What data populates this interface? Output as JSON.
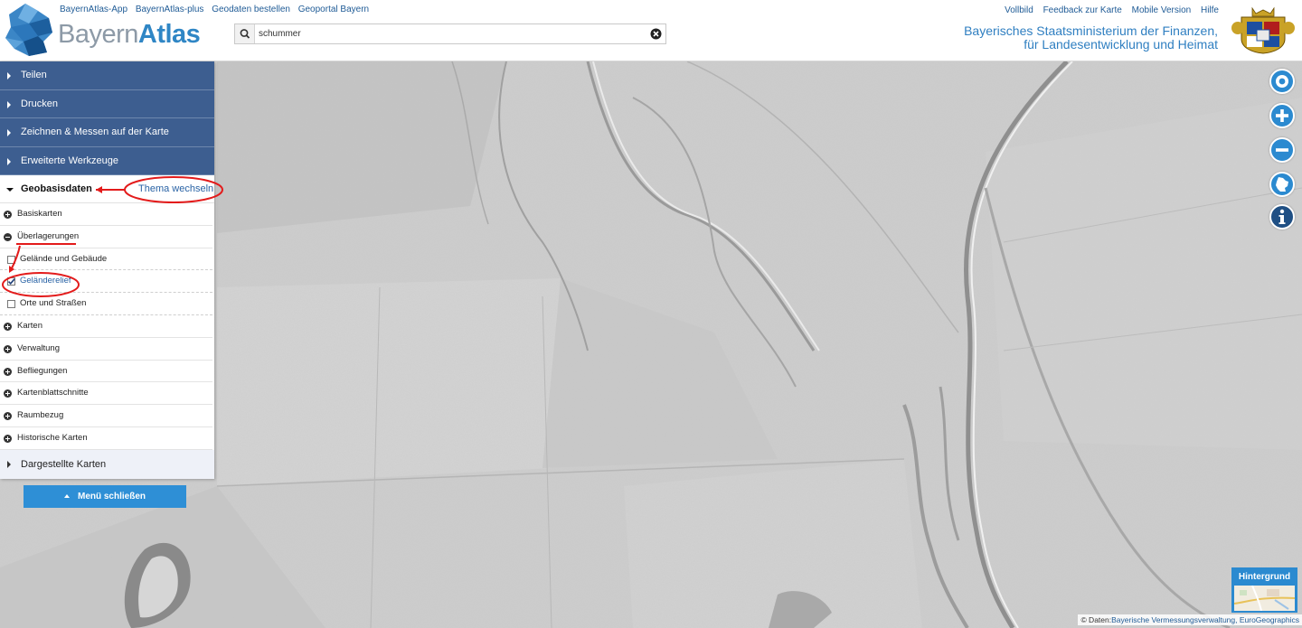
{
  "header": {
    "top_links": [
      "BayernAtlas-App",
      "BayernAtlas-plus",
      "Geodaten bestellen",
      "Geoportal Bayern"
    ],
    "brand_part1": "Bayern",
    "brand_part2": "Atlas",
    "right_links": [
      "Vollbild",
      "Feedback zur Karte",
      "Mobile Version",
      "Hilfe"
    ],
    "ministry_line1": "Bayerisches Staatsministerium der Finanzen,",
    "ministry_line2": "für Landesentwicklung und Heimat"
  },
  "search": {
    "value": "schummer"
  },
  "menu": {
    "accordion": [
      "Teilen",
      "Drucken",
      "Zeichnen & Messen auf der Karte",
      "Erweiterte Werkzeuge"
    ],
    "active_section": "Geobasisdaten",
    "theme_link": "Thema wechseln",
    "tree": {
      "basiskarten": "Basiskarten",
      "ueberlagerungen": "Überlagerungen",
      "sub_gelaende": "Gelände und Gebäude",
      "sub_relief": "Geländerelief",
      "sub_orte": "Orte und Straßen",
      "karten": "Karten",
      "verwaltung": "Verwaltung",
      "befliegungen": "Befliegungen",
      "kartenblattschnitte": "Kartenblattschnitte",
      "raumbezug": "Raumbezug",
      "historische": "Historische Karten"
    },
    "dargestellte": "Dargestellte Karten",
    "close_button": "Menü schließen"
  },
  "checked": {
    "sub_gelaende": false,
    "sub_relief": true,
    "sub_orte": false
  },
  "controls": {
    "icons": [
      "location-icon",
      "zoom-in-icon",
      "zoom-out-icon",
      "bavaria-icon",
      "info-icon"
    ],
    "background_label": "Hintergrund"
  },
  "attribution": {
    "prefix": "© Daten:",
    "sources": "Bayerische Vermessungsverwaltung, EuroGeographics"
  },
  "colors": {
    "menu_blue": "#3d5e90",
    "accent_blue": "#2b8ad0",
    "annotation_red": "#e31b1b"
  }
}
